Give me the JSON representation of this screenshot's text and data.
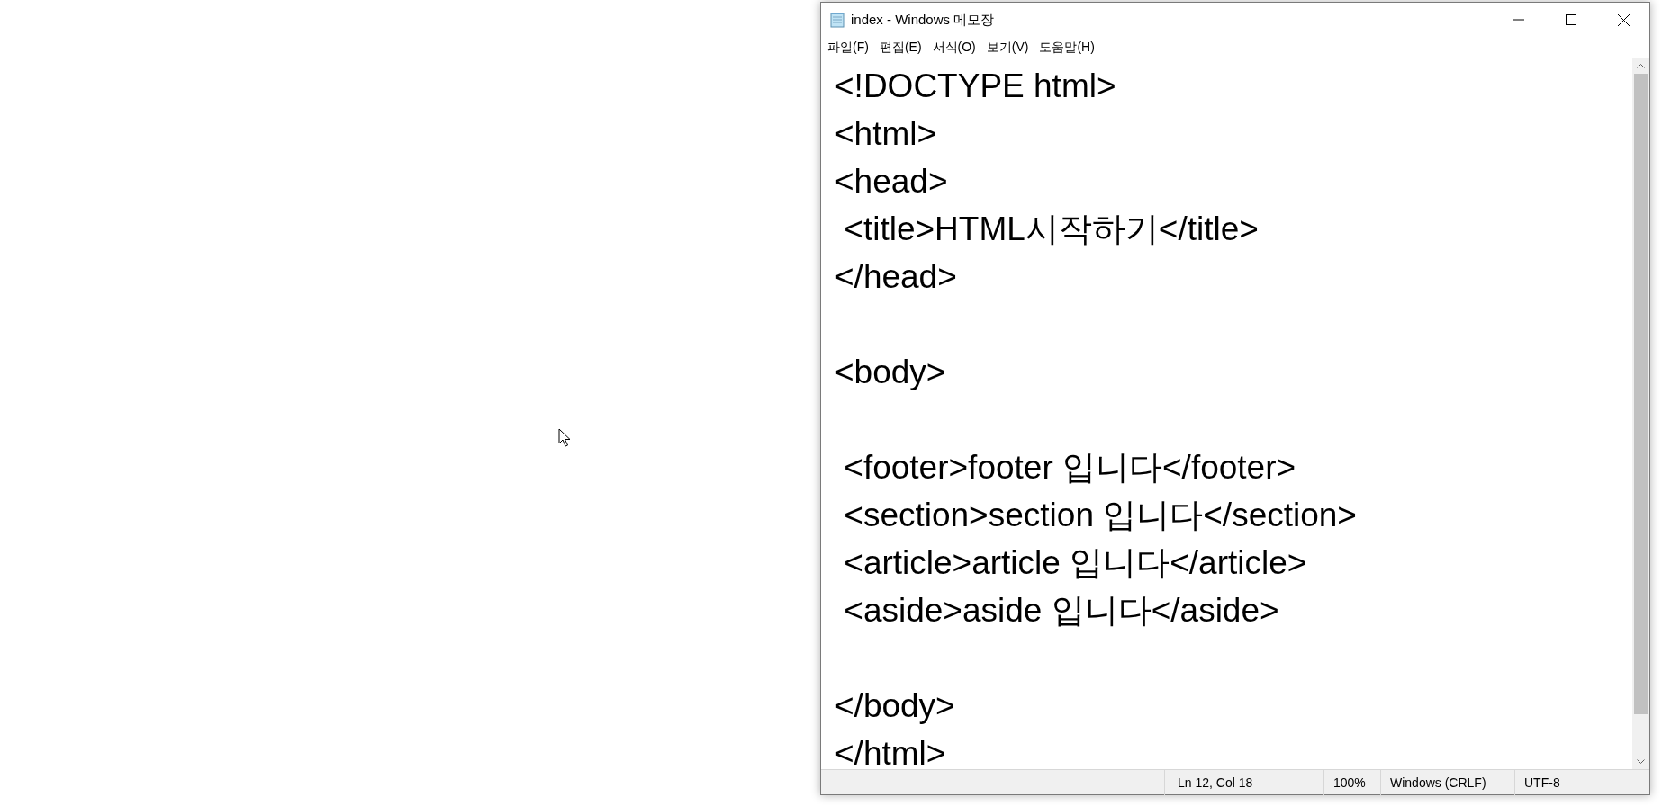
{
  "window": {
    "title": "index - Windows 메모장"
  },
  "menu": [
    "파일(F)",
    "편집(E)",
    "서식(O)",
    "보기(V)",
    "도움말(H)"
  ],
  "editor": {
    "lines": [
      {
        "kind": "text",
        "text": "<!DOCTYPE html>"
      },
      {
        "kind": "text",
        "text": "<html>"
      },
      {
        "kind": "text",
        "text": "<head>"
      },
      {
        "kind": "text",
        "text": " <title>HTML시작하기</title>"
      },
      {
        "kind": "text",
        "text": "</head>"
      },
      {
        "kind": "blank"
      },
      {
        "kind": "text",
        "text": "<body>"
      },
      {
        "kind": "blank"
      },
      {
        "kind": "text",
        "text": " <footer>footer 입니다</footer>"
      },
      {
        "kind": "text",
        "text": " <section>section 입니다</section>"
      },
      {
        "kind": "text",
        "text": " <article>article 입니다</article>"
      },
      {
        "kind": "text",
        "text": " <aside>aside 입니다</aside>"
      },
      {
        "kind": "blank"
      },
      {
        "kind": "text",
        "text": "</body>"
      },
      {
        "kind": "text",
        "text": "</html>"
      }
    ]
  },
  "status_bar": {
    "position": "Ln 12, Col 18",
    "zoom": "100%",
    "line_ending": "Windows (CRLF)",
    "encoding": "UTF-8"
  }
}
